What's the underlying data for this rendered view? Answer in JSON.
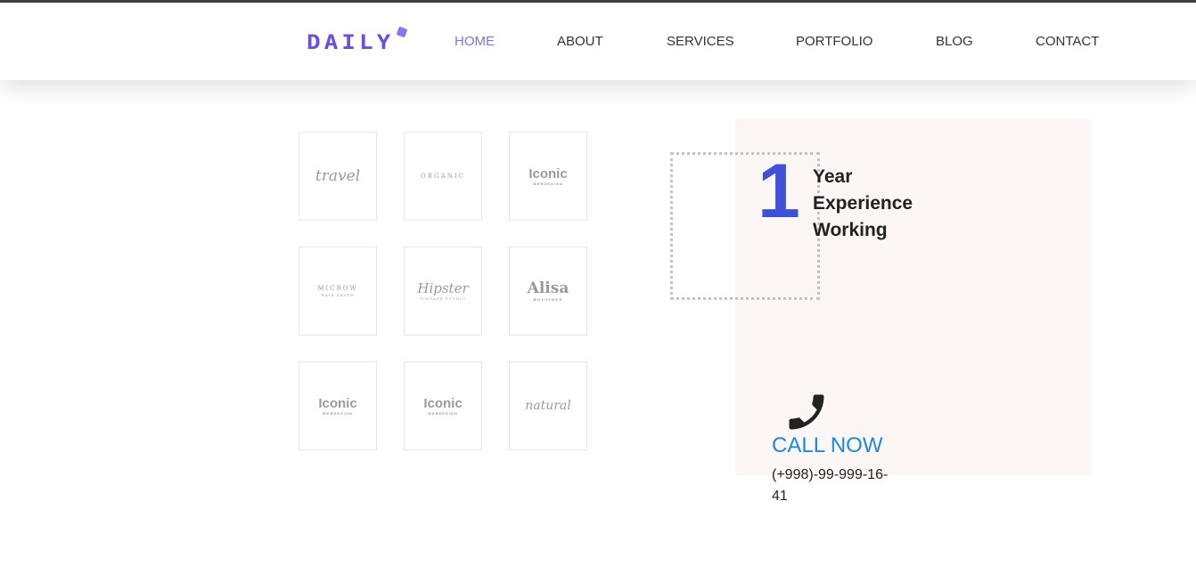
{
  "header": {
    "logo_text": "DAILY",
    "nav": [
      {
        "label": "HOME",
        "active": true
      },
      {
        "label": "ABOUT",
        "active": false
      },
      {
        "label": "SERVICES",
        "active": false
      },
      {
        "label": "PORTFOLIO",
        "active": false
      },
      {
        "label": "BLOG",
        "active": false
      },
      {
        "label": "CONTACT",
        "active": false
      }
    ]
  },
  "clients": [
    {
      "name": "travel",
      "sub": ""
    },
    {
      "name": "ORGANIC",
      "sub": ""
    },
    {
      "name": "Iconic",
      "sub": "WEBDESIGN"
    },
    {
      "name": "MICROW",
      "sub": "HAIR SALON"
    },
    {
      "name": "Hipster",
      "sub": "VINTAGE STUDIO"
    },
    {
      "name": "Alisa",
      "sub": "BOUTIQUE"
    },
    {
      "name": "Iconic",
      "sub": "WEBDESIGN"
    },
    {
      "name": "Iconic",
      "sub": "WEBDESIGN"
    },
    {
      "name": "natural",
      "sub": ""
    }
  ],
  "experience": {
    "number": "1",
    "line1": "Year",
    "line2": "Experience",
    "line3": "Working"
  },
  "contact": {
    "icon": "phone-icon",
    "call_label": "CALL NOW",
    "phone": "(+998)-99-999-16-41"
  },
  "colors": {
    "accent": "#6a4fe0",
    "nav_active": "#8270dc",
    "number": "#3f51d8",
    "call": "#1e88e5",
    "panel": "#fcf6f5"
  }
}
